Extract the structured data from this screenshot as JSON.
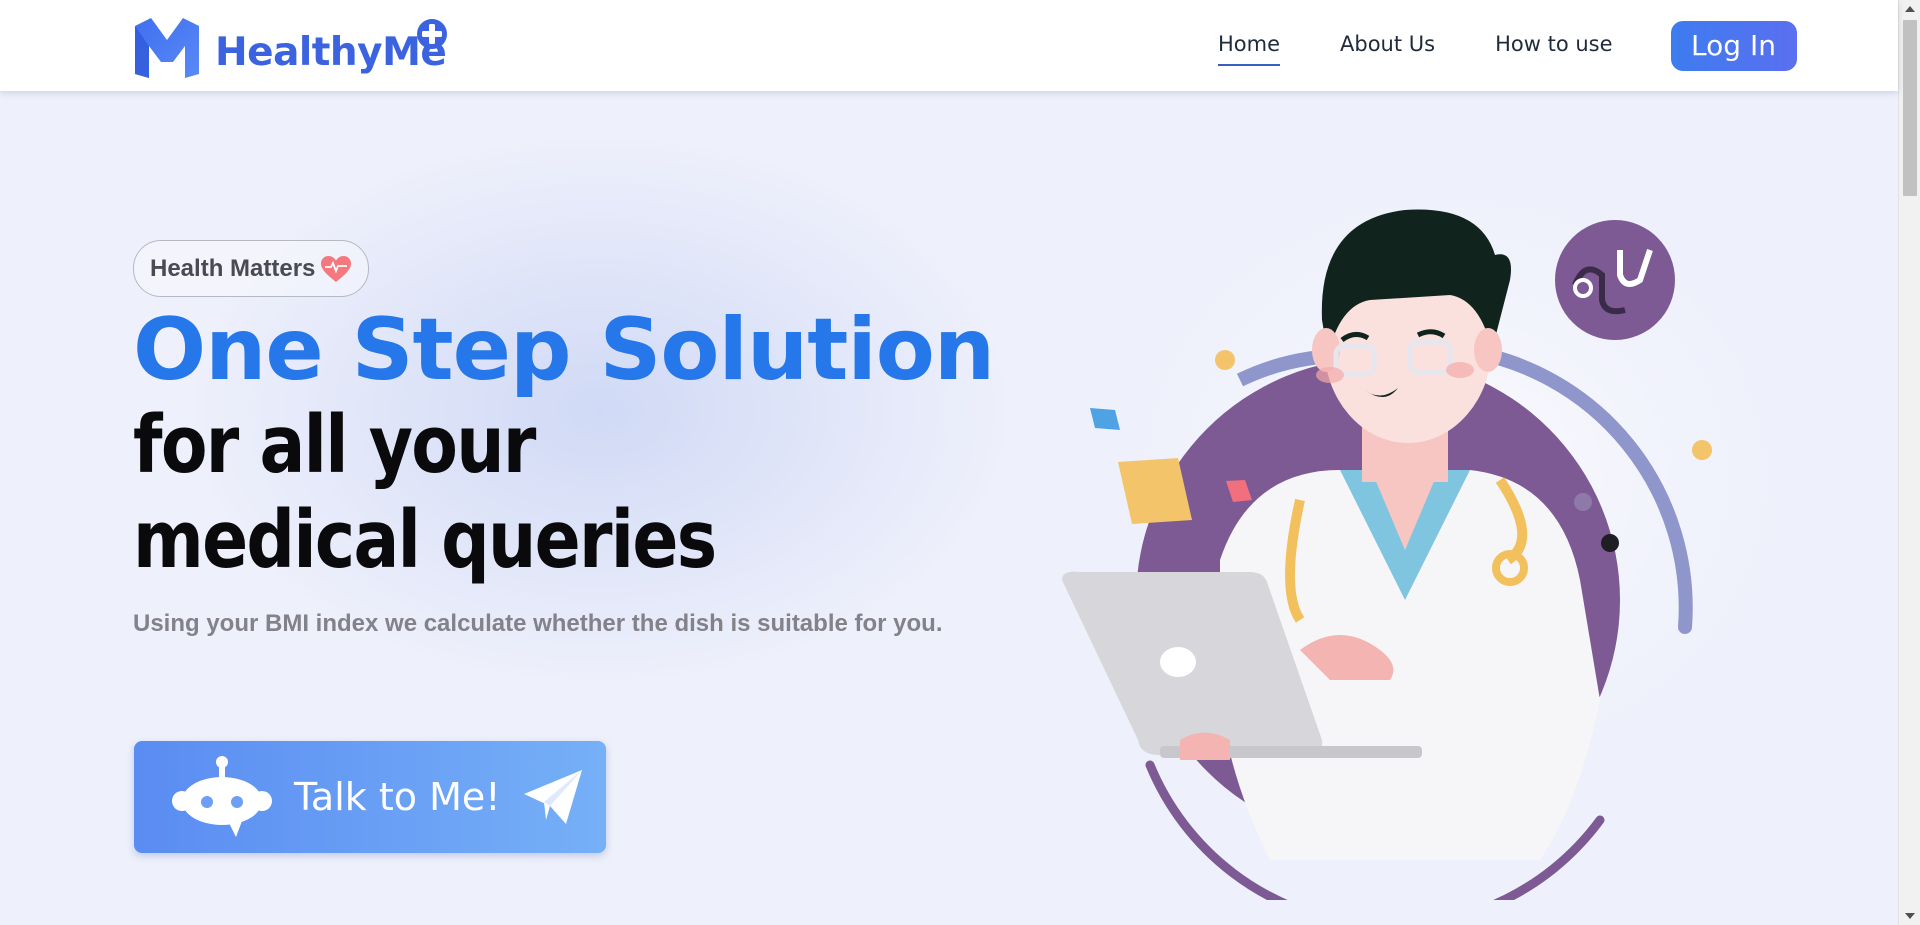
{
  "brand": {
    "name": "HealthyMe",
    "logo_icon": "m-logo-icon",
    "plus_icon": "plus-badge-icon",
    "colors": {
      "primary": "#3b63e0"
    }
  },
  "nav": {
    "items": [
      {
        "label": "Home",
        "active": true
      },
      {
        "label": "About Us",
        "active": false
      },
      {
        "label": "How to use",
        "active": false
      }
    ],
    "login_label": "Log In"
  },
  "hero": {
    "badge": {
      "label": "Health Matters",
      "icon": "heart-icon"
    },
    "headline_accent": "One Step Solution",
    "headline_rest": "for all your medical queries",
    "subtitle": "Using your BMI index we calculate whether the dish is suitable for you.",
    "cta": {
      "label": "Talk to Me!",
      "leading_icon": "robot-icon",
      "trailing_icon": "paper-plane-icon"
    },
    "illustration": "doctor-with-laptop-illustration"
  },
  "colors": {
    "background": "#eef0fb",
    "accent_blue": "#2577ea",
    "headline_dark": "#0a0a0c",
    "subtitle_gray": "#83818a",
    "illustration_purple": "#7d5a94"
  }
}
